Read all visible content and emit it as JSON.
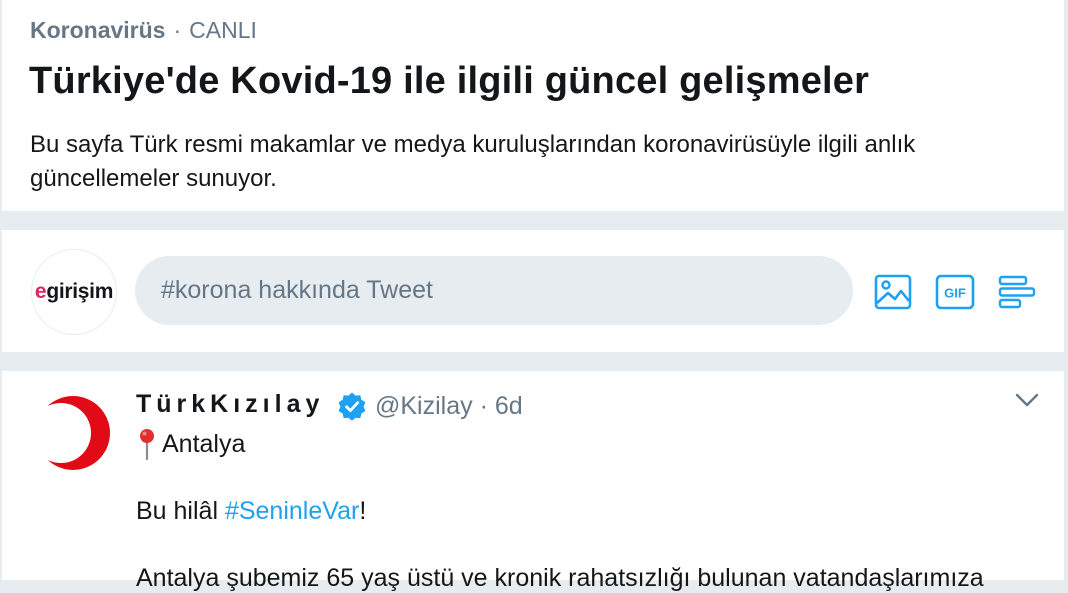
{
  "header": {
    "topic": "Koronavirüs",
    "separator": "·",
    "live_label": "CANLI",
    "title": "Türkiye'de Kovid-19 ile ilgili güncel gelişmeler",
    "description": "Bu sayfa Türk resmi makamlar ve medya kuruluşlarından koronavirüsüyle ilgili anlık güncellemeler sunuyor."
  },
  "compose": {
    "avatar_prefix": "e",
    "avatar_rest": "girişim",
    "placeholder": "#korona hakkında Tweet",
    "toolbar_icons": [
      "image-icon",
      "gif-icon",
      "poll-icon"
    ],
    "gif_label": "GIF"
  },
  "tweet": {
    "display_name": "TürkKızılay",
    "handle_time": "@Kizilay · 6d",
    "location": "Antalya",
    "text_before_tag": "Bu hilâl ",
    "hashtag": "#SeninleVar",
    "text_after_tag": "!",
    "text_line2": "Antalya şubemiz 65 yaş üstü ve kronik rahatsızlığı bulunan vatandaşlarımıza"
  },
  "colors": {
    "accent": "#1da1f2",
    "background": "#e6ecf0",
    "muted_text": "#657786",
    "kizilay_red": "#e30a17",
    "brand_pink": "#e0245e"
  }
}
